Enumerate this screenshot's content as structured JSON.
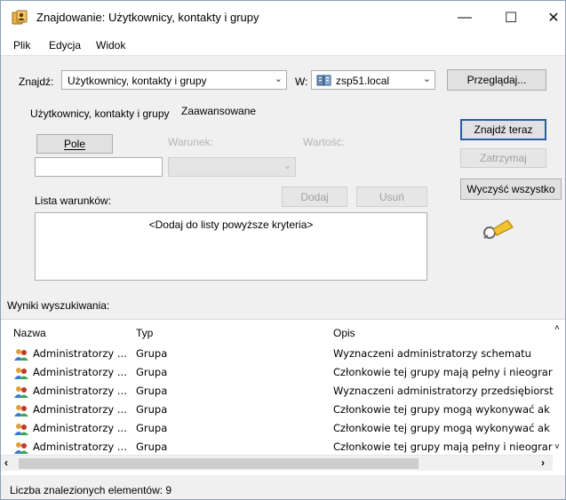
{
  "window": {
    "title": "Znajdowanie: Użytkownicy, kontakty i grupy",
    "controls": {
      "minimize": "—",
      "maximize": "☐",
      "close": "✕"
    }
  },
  "menu": [
    "Plik",
    "Edycja",
    "Widok"
  ],
  "search": {
    "find_label": "Znajdź:",
    "find_value": "Użytkownicy, kontakty i grupy",
    "in_label": "W:",
    "in_value": "zsp51.local",
    "browse_button": "Przeglądaj..."
  },
  "tabs": [
    "Użytkownicy, kontakty i grupy",
    "Zaawansowane"
  ],
  "advanced": {
    "field_button": "Pole",
    "condition_label": "Warunek:",
    "value_label": "Wartość:",
    "condition_list_label": "Lista warunków:",
    "add_button": "Dodaj",
    "remove_button": "Usuń",
    "empty_list_text": "<Dodaj do listy powyższe kryteria>"
  },
  "actions": {
    "find_now": "Znajdź teraz",
    "stop": "Zatrzymaj",
    "clear_all": "Wyczyść wszystko"
  },
  "results": {
    "label": "Wyniki wyszukiwania:",
    "columns": [
      "Nazwa",
      "Typ",
      "Opis"
    ],
    "rows": [
      {
        "name": "Administratorzy ...",
        "type": "Grupa",
        "description": "Wyznaczeni administratorzy schematu"
      },
      {
        "name": "Administratorzy ...",
        "type": "Grupa",
        "description": "Członkowie tej grupy mają pełny i nieograr"
      },
      {
        "name": "Administratorzy ...",
        "type": "Grupa",
        "description": "Wyznaczeni administratorzy przedsiębiorst"
      },
      {
        "name": "Administratorzy ...",
        "type": "Grupa",
        "description": "Członkowie tej grupy mogą wykonywać ak"
      },
      {
        "name": "Administratorzy ...",
        "type": "Grupa",
        "description": "Członkowie tej grupy mogą wykonywać ak"
      },
      {
        "name": "Administratorzy ...",
        "type": "Grupa",
        "description": "Członkowie tej grupy mają pełny i nieograr"
      }
    ]
  },
  "status": "Liczba znalezionych elementów: 9",
  "icons": {
    "app": "find-users-icon",
    "domain": "domain-icon",
    "group": "group-icon",
    "search_anim": "flashlight-icon"
  },
  "colors": {
    "accent": "#2a5aa8",
    "titlebar": "#ffffff",
    "face": "#f0f0f0"
  }
}
